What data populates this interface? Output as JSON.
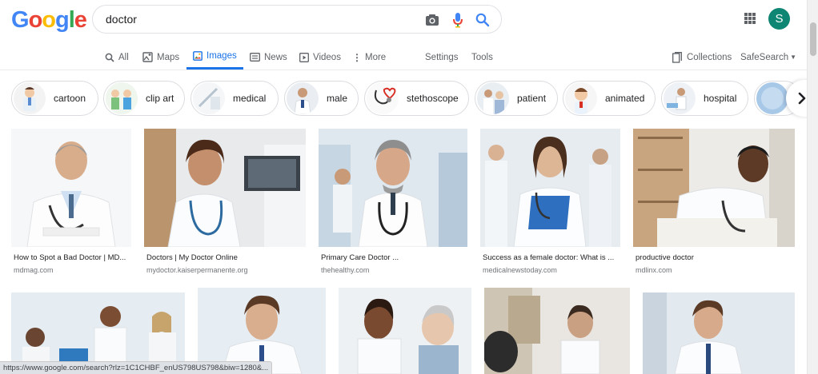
{
  "logo": {
    "letters": [
      "G",
      "o",
      "o",
      "g",
      "l",
      "e"
    ],
    "colors": [
      "#4285F4",
      "#EA4335",
      "#FBBC05",
      "#4285F4",
      "#34A853",
      "#EA4335"
    ]
  },
  "search": {
    "value": "doctor",
    "camera_icon": "camera-icon",
    "mic_icon": "mic-icon",
    "search_icon": "search-icon"
  },
  "account": {
    "initial": "S",
    "color": "#0f8573"
  },
  "tabs": [
    {
      "label": "All",
      "icon": "search-icon"
    },
    {
      "label": "Maps",
      "icon": "map-icon"
    },
    {
      "label": "Images",
      "icon": "image-icon",
      "active": true
    },
    {
      "label": "News",
      "icon": "news-icon"
    },
    {
      "label": "Videos",
      "icon": "video-icon"
    },
    {
      "label": "More",
      "icon": "more-icon"
    }
  ],
  "tools": {
    "settings": "Settings",
    "tools": "Tools",
    "collections": "Collections",
    "safesearch": "SafeSearch"
  },
  "chips": [
    {
      "label": "cartoon"
    },
    {
      "label": "clip art"
    },
    {
      "label": "medical"
    },
    {
      "label": "male"
    },
    {
      "label": "stethoscope"
    },
    {
      "label": "patient"
    },
    {
      "label": "animated"
    },
    {
      "label": "hospital"
    }
  ],
  "results": [
    {
      "title": "How to Spot a Bad Doctor | MD...",
      "source": "mdmag.com"
    },
    {
      "title": "Doctors | My Doctor Online",
      "source": "mydoctor.kaiserpermanente.org"
    },
    {
      "title": "Primary Care Doctor ...",
      "source": "thehealthy.com"
    },
    {
      "title": "Success as a female doctor: What is ...",
      "source": "medicalnewstoday.com"
    },
    {
      "title": "productive doctor",
      "source": "mdlinx.com"
    }
  ],
  "status_url": "https://www.google.com/search?rlz=1C1CHBF_enUS798US798&biw=1280&..."
}
